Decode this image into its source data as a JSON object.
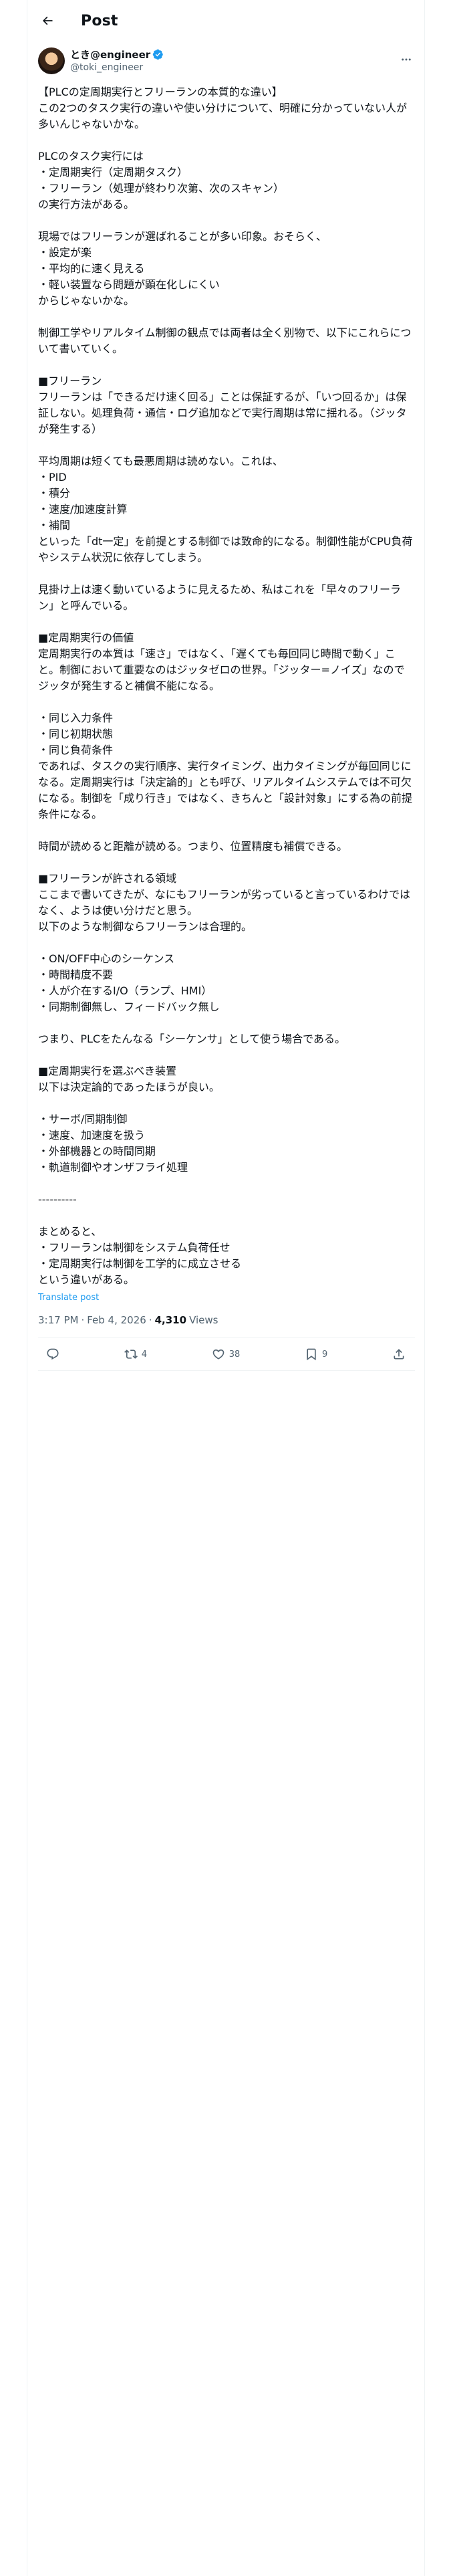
{
  "header": {
    "title": "Post",
    "back_icon": "arrow-left-icon"
  },
  "author": {
    "display_name": "とき@engineer",
    "handle": "@toki_engineer",
    "verified": true,
    "verified_color": "#1d9bf0"
  },
  "post": {
    "text": "【PLCの定周期実行とフリーランの本質的な違い】\nこの2つのタスク実行の違いや使い分けについて、明確に分かっていない人が多いんじゃないかな。\n\nPLCのタスク実行には\n・定周期実行（定周期タスク）\n・フリーラン（処理が終わり次第、次のスキャン）\nの実行方法がある。\n\n現場ではフリーランが選ばれることが多い印象。おそらく、\n・設定が楽\n・平均的に速く見える\n・軽い装置なら問題が顕在化しにくい\nからじゃないかな。\n\n制御工学やリアルタイム制御の観点では両者は全く別物で、以下にこれらについて書いていく。\n\n■フリーラン\nフリーランは「できるだけ速く回る」ことは保証するが、「いつ回るか」は保証しない。処理負荷・通信・ログ追加などで実行周期は常に揺れる。（ジッタが発生する）\n\n平均周期は短くても最悪周期は読めない。これは、\n・PID\n・積分\n・速度/加速度計算\n・補間\nといった「dt一定」を前提とする制御では致命的になる。制御性能がCPU負荷やシステム状況に依存してしまう。\n\n見掛け上は速く動いているように見えるため、私はこれを「早々のフリーラン」と呼んでいる。\n\n■定周期実行の価値\n定周期実行の本質は「速さ」ではなく、「遅くても毎回同じ時間で動く」こと。制御において重要なのはジッタゼロの世界。「ジッター=ノイズ」なので ジッタが発生すると補償不能になる。\n\n・同じ入力条件\n・同じ初期状態\n・同じ負荷条件\nであれば、タスクの実行順序、実行タイミング、出力タイミングが毎回同じになる。定周期実行は「決定論的」とも呼び、リアルタイムシステムでは不可欠になる。制御を「成り行き」ではなく、きちんと「設計対象」にする為の前提条件になる。\n\n時間が読めると距離が読める。つまり、位置精度も補償できる。\n\n■フリーランが許される領域\nここまで書いてきたが、なにもフリーランが劣っていると言っているわけではなく、ようは使い分けだと思う。\n以下のような制御ならフリーランは合理的。\n\n・ON/OFF中心のシーケンス\n・時間精度不要\n・人が介在するI/O（ランプ、HMI）\n・同期制御無し、フィードバック無し\n\nつまり、PLCをたんなる「シーケンサ」として使う場合である。\n\n■定周期実行を選ぶべき装置\n以下は決定論的であったほうが良い。\n\n・サーボ/同期制御\n・速度、加速度を扱う\n・外部機器との時間同期\n・軌道制御やオンザフライ処理\n\n----------\n\nまとめると、\n・フリーランは制御をシステム負荷任せ\n・定周期実行は制御を工学的に成立させる\nという違いがある。",
    "translate_label": "Translate post",
    "time": "3:17 PM",
    "date": "Feb 4, 2026",
    "separator": "·",
    "views_count": "4,310",
    "views_label": "Views"
  },
  "actions": {
    "reply_icon": "reply-icon",
    "repost_icon": "repost-icon",
    "repost_count": "4",
    "like_icon": "heart-icon",
    "like_count": "38",
    "bookmark_icon": "bookmark-icon",
    "bookmark_count": "9",
    "share_icon": "share-icon"
  },
  "colors": {
    "text": "#0f1419",
    "secondary": "#536471",
    "link": "#1d9bf0",
    "border": "#eff3f4"
  }
}
